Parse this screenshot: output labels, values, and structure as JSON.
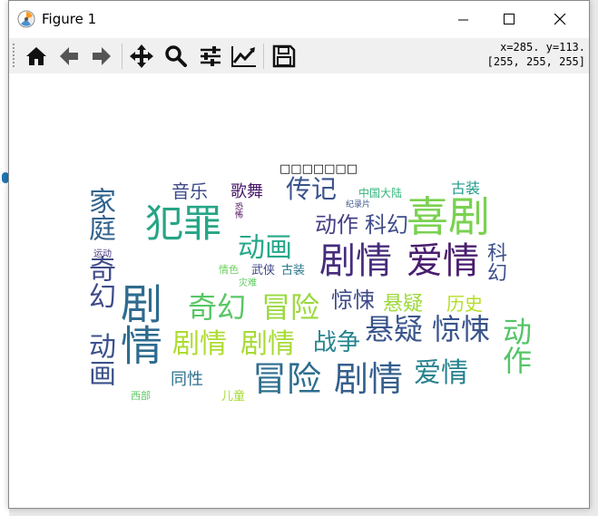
{
  "window": {
    "title": "Figure 1"
  },
  "toolbar": {
    "buttons": [
      {
        "name": "home-button",
        "icon": "home-icon"
      },
      {
        "name": "back-button",
        "icon": "arrow-left-icon"
      },
      {
        "name": "forward-button",
        "icon": "arrow-right-icon"
      },
      {
        "name": "pan-button",
        "icon": "move-icon"
      },
      {
        "name": "zoom-button",
        "icon": "magnifier-icon"
      },
      {
        "name": "subplots-button",
        "icon": "sliders-icon"
      },
      {
        "name": "edit-axes-button",
        "icon": "line-chart-icon"
      },
      {
        "name": "save-button",
        "icon": "floppy-disk-icon"
      }
    ],
    "coords_line1": "x=285. y=113.",
    "coords_line2": "[255, 255, 255]"
  },
  "figure": {
    "title": "□□□□□□□",
    "words": [
      {
        "text": "剧情",
        "color": "#2f6b8e"
      },
      {
        "text": "剧情",
        "color": "#462c7b"
      },
      {
        "text": "爱情",
        "color": "#4a1d6e"
      },
      {
        "text": "喜剧",
        "color": "#7ad151"
      },
      {
        "text": "犯罪",
        "color": "#26a585"
      },
      {
        "text": "冒险",
        "color": "#2e6d8e"
      },
      {
        "text": "剧情",
        "color": "#355f8d"
      },
      {
        "text": "冒险",
        "color": "#9ad93c"
      },
      {
        "text": "奇幻",
        "color": "#58c765"
      },
      {
        "text": "剧情",
        "color": "#aedc30"
      },
      {
        "text": "剧情",
        "color": "#a7db35"
      },
      {
        "text": "动画",
        "color": "#24a88a"
      },
      {
        "text": "家庭",
        "color": "#33638d"
      },
      {
        "text": "奇幻",
        "color": "#3f4b89"
      },
      {
        "text": "动画",
        "color": "#3b518b"
      },
      {
        "text": "动作",
        "color": "#54c568"
      },
      {
        "text": "惊悚",
        "color": "#3a548c"
      },
      {
        "text": "悬疑",
        "color": "#39558c"
      },
      {
        "text": "爱情",
        "color": "#26828e"
      },
      {
        "text": "传记",
        "color": "#3a538b"
      },
      {
        "text": "动作",
        "color": "#433e85"
      },
      {
        "text": "科幻",
        "color": "#3e4c8a"
      },
      {
        "text": "惊悚",
        "color": "#3e4a89"
      },
      {
        "text": "战争",
        "color": "#25848e"
      },
      {
        "text": "悬疑",
        "color": "#9dd93b"
      },
      {
        "text": "历史",
        "color": "#b5de2b"
      },
      {
        "text": "科幻",
        "color": "#3c4f8a"
      },
      {
        "text": "音乐",
        "color": "#3e4a89"
      },
      {
        "text": "歌舞",
        "color": "#48186a"
      },
      {
        "text": "古装",
        "color": "#1f9a8a"
      },
      {
        "text": "同性",
        "color": "#2d708e"
      },
      {
        "text": "武侠",
        "color": "#404588"
      },
      {
        "text": "古装",
        "color": "#2a768e"
      },
      {
        "text": "中国大陆",
        "color": "#32b67a"
      },
      {
        "text": "恐怖",
        "color": "#440154"
      },
      {
        "text": "纪录片",
        "color": "#3b528b"
      },
      {
        "text": "运动",
        "color": "#46327e"
      },
      {
        "text": "情色",
        "color": "#6ccd5a"
      },
      {
        "text": "灾难",
        "color": "#5ec962"
      },
      {
        "text": "儿童",
        "color": "#a5db36"
      },
      {
        "text": "西部",
        "color": "#5ec962"
      }
    ]
  }
}
